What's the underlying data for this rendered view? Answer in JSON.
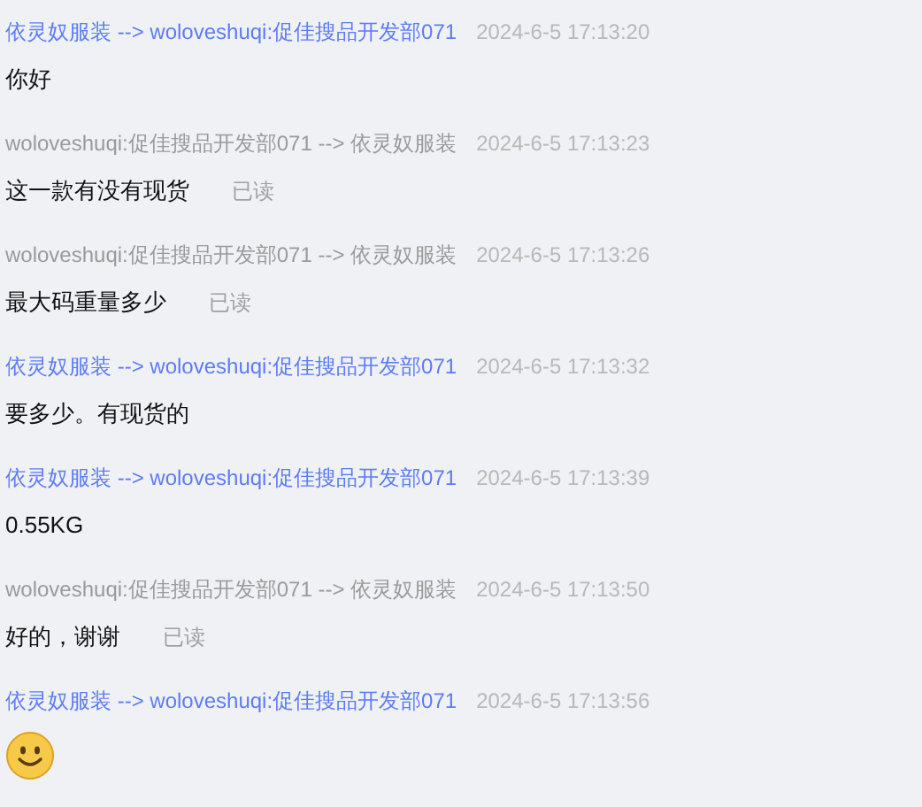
{
  "messages": [
    {
      "outgoing": true,
      "header": "依灵奴服装 --> woloveshuqi:促佳搜品开发部071",
      "time": "2024-6-5 17:13:20",
      "kind": "text",
      "body": "你好"
    },
    {
      "outgoing": false,
      "header": "woloveshuqi:促佳搜品开发部071 --> 依灵奴服装",
      "time": "2024-6-5 17:13:23",
      "kind": "text",
      "body": "这一款有没有现货",
      "status": "已读"
    },
    {
      "outgoing": false,
      "header": "woloveshuqi:促佳搜品开发部071 --> 依灵奴服装",
      "time": "2024-6-5 17:13:26",
      "kind": "text",
      "body": "最大码重量多少",
      "status": "已读"
    },
    {
      "outgoing": true,
      "header": "依灵奴服装 --> woloveshuqi:促佳搜品开发部071",
      "time": "2024-6-5 17:13:32",
      "kind": "text",
      "body": "要多少。有现货的"
    },
    {
      "outgoing": true,
      "header": "依灵奴服装 --> woloveshuqi:促佳搜品开发部071",
      "time": "2024-6-5 17:13:39",
      "kind": "text",
      "body": "0.55KG"
    },
    {
      "outgoing": false,
      "header": "woloveshuqi:促佳搜品开发部071 --> 依灵奴服装",
      "time": "2024-6-5 17:13:50",
      "kind": "text",
      "body": "好的，谢谢",
      "status": "已读"
    },
    {
      "outgoing": true,
      "header": "依灵奴服装 --> woloveshuqi:促佳搜品开发部071",
      "time": "2024-6-5 17:13:56",
      "kind": "emoji"
    }
  ]
}
